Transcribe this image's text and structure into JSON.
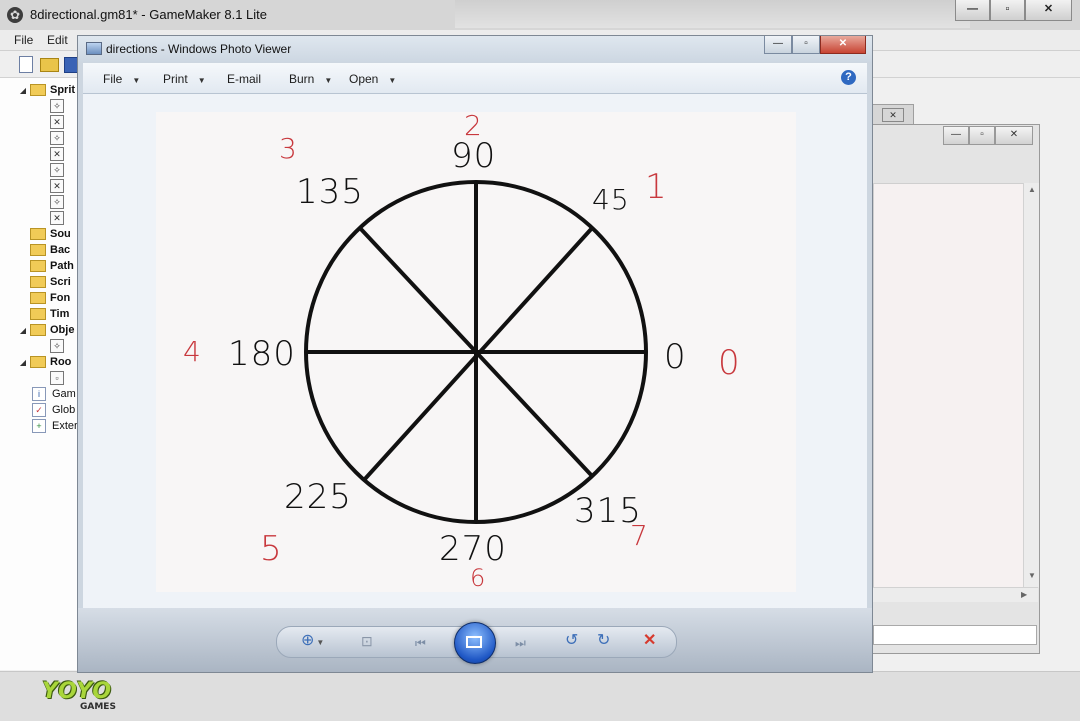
{
  "gamemaker": {
    "title": "8directional.gm81* - GameMaker 8.1 Lite",
    "menu": {
      "file": "File",
      "edit": "Edit"
    },
    "tree": {
      "groups": [
        {
          "label": "Sprit"
        },
        {
          "label": "Sou"
        },
        {
          "label": "Bac"
        },
        {
          "label": "Path"
        },
        {
          "label": "Scri"
        },
        {
          "label": "Fon"
        },
        {
          "label": "Tim"
        },
        {
          "label": "Obje"
        },
        {
          "label": "Roo"
        }
      ],
      "items": [
        {
          "label": "Gam"
        },
        {
          "label": "Glob"
        },
        {
          "label": "Exter"
        }
      ]
    },
    "logo": {
      "word": "YOYO",
      "sub": "GAMES"
    }
  },
  "photo_viewer": {
    "title": "directions - Windows Photo Viewer",
    "menu": {
      "file": "File",
      "print": "Print",
      "email": "E-mail",
      "burn": "Burn",
      "open": "Open"
    },
    "help": "?"
  },
  "drawing": {
    "angles": [
      "90",
      "45",
      "0",
      "315",
      "270",
      "225",
      "180",
      "135"
    ],
    "direction_numbers": [
      "2",
      "1",
      "0",
      "7",
      "6",
      "5",
      "4",
      "3"
    ],
    "angle_color": "#111111",
    "direction_color": "#c8383d"
  },
  "colors": {
    "pv_close": "#c84433",
    "accent_blue": "#1e56c4"
  }
}
